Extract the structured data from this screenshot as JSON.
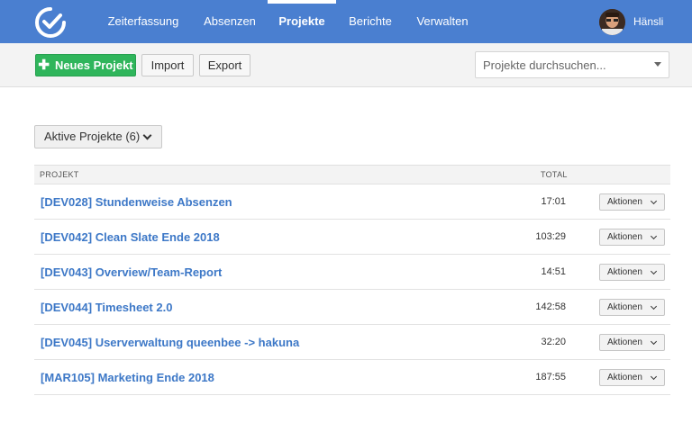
{
  "nav": {
    "items": [
      {
        "label": "Zeiterfassung"
      },
      {
        "label": "Absenzen"
      },
      {
        "label": "Projekte"
      },
      {
        "label": "Berichte"
      },
      {
        "label": "Verwalten"
      }
    ],
    "active": "Projekte",
    "user": "Hänsli",
    "accent": "#4a7fd0"
  },
  "toolbar": {
    "new_project": "Neues Projekt",
    "import": "Import",
    "export": "Export",
    "search_placeholder": "Projekte durchsuchen..."
  },
  "filter": {
    "label": "Aktive Projekte (6)"
  },
  "table": {
    "col_project": "PROJEKT",
    "col_total": "TOTAL",
    "rows": [
      {
        "name": "[DEV028] Stundenweise Absenzen",
        "total": "17:01",
        "action": "Aktionen"
      },
      {
        "name": "[DEV042] Clean Slate Ende 2018",
        "total": "103:29",
        "action": "Aktionen"
      },
      {
        "name": "[DEV043] Overview/Team-Report",
        "total": "14:51",
        "action": "Aktionen"
      },
      {
        "name": "[DEV044] Timesheet 2.0",
        "total": "142:58",
        "action": "Aktionen"
      },
      {
        "name": "[DEV045] Userverwaltung queenbee -> hakuna",
        "total": "32:20",
        "action": "Aktionen"
      },
      {
        "name": "[MAR105] Marketing Ende 2018",
        "total": "187:55",
        "action": "Aktionen"
      }
    ]
  }
}
